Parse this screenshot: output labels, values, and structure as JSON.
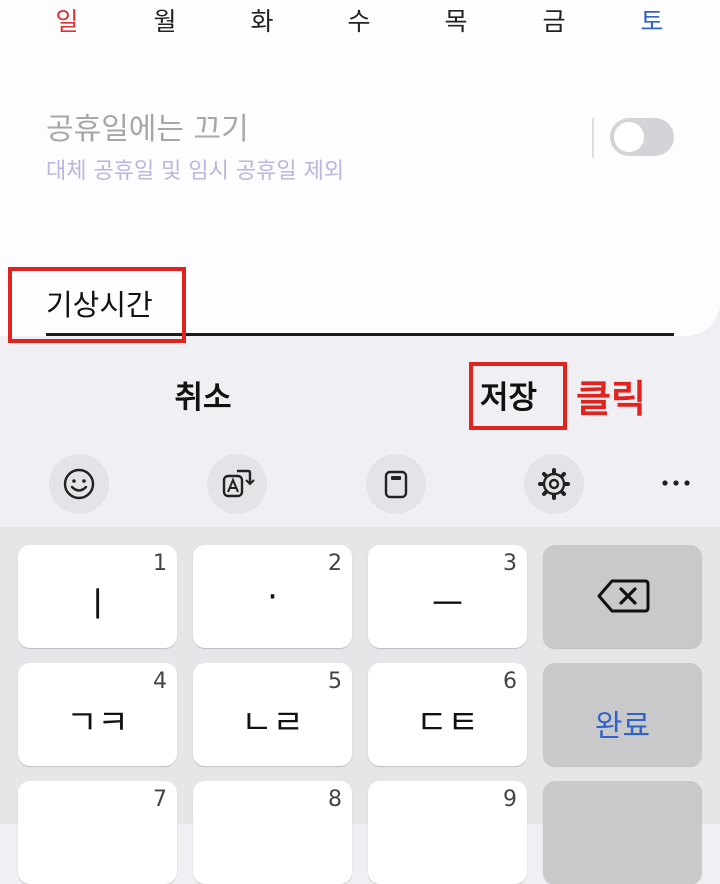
{
  "weekdays": {
    "sun": "일",
    "mon": "월",
    "tue": "화",
    "wed": "수",
    "thu": "목",
    "fri": "금",
    "sat": "토"
  },
  "holiday": {
    "title": "공휴일에는 끄기",
    "subtitle": "대체 공휴일 및 임시 공휴일 제외",
    "toggle_on": false
  },
  "alarm_name": {
    "value": "기상시간"
  },
  "actions": {
    "cancel": "취소",
    "save": "저장"
  },
  "annotation": {
    "click_label": "클릭",
    "color": "#e0231f"
  },
  "toolbar": {
    "icons": [
      "emoji-icon",
      "translate-icon",
      "clipboard-icon",
      "settings-icon",
      "more-icon"
    ]
  },
  "keyboard": {
    "row1": [
      {
        "label": "ㅣ",
        "num": "1"
      },
      {
        "label": "·",
        "num": "2"
      },
      {
        "label": "ㅡ",
        "num": "3"
      }
    ],
    "row2": [
      {
        "label": "ㄱㅋ",
        "num": "4"
      },
      {
        "label": "ㄴㄹ",
        "num": "5"
      },
      {
        "label": "ㄷㅌ",
        "num": "6"
      }
    ],
    "row3": [
      {
        "label": "",
        "num": "7"
      },
      {
        "label": "",
        "num": "8"
      },
      {
        "label": "",
        "num": "9"
      }
    ],
    "done": "완료"
  },
  "colors": {
    "sunday": "#d63232",
    "saturday": "#2f63c8",
    "highlight": "#e0231f",
    "done_text": "#2f63c8"
  }
}
